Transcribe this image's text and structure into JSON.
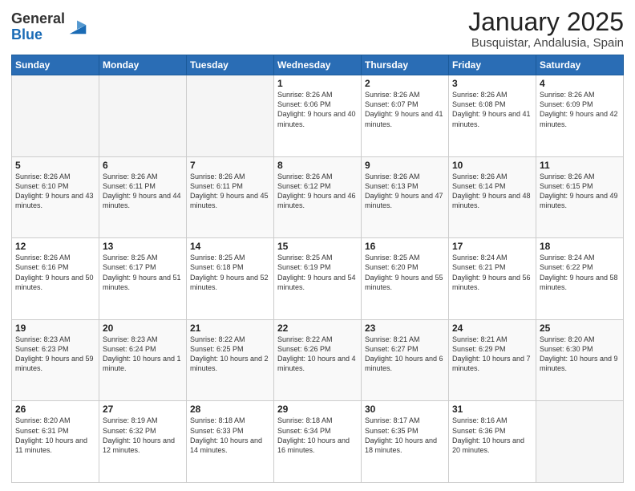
{
  "logo": {
    "general": "General",
    "blue": "Blue"
  },
  "header": {
    "title": "January 2025",
    "subtitle": "Busquistar, Andalusia, Spain"
  },
  "weekdays": [
    "Sunday",
    "Monday",
    "Tuesday",
    "Wednesday",
    "Thursday",
    "Friday",
    "Saturday"
  ],
  "weeks": [
    [
      {
        "day": "",
        "info": ""
      },
      {
        "day": "",
        "info": ""
      },
      {
        "day": "",
        "info": ""
      },
      {
        "day": "1",
        "info": "Sunrise: 8:26 AM\nSunset: 6:06 PM\nDaylight: 9 hours and 40 minutes."
      },
      {
        "day": "2",
        "info": "Sunrise: 8:26 AM\nSunset: 6:07 PM\nDaylight: 9 hours and 41 minutes."
      },
      {
        "day": "3",
        "info": "Sunrise: 8:26 AM\nSunset: 6:08 PM\nDaylight: 9 hours and 41 minutes."
      },
      {
        "day": "4",
        "info": "Sunrise: 8:26 AM\nSunset: 6:09 PM\nDaylight: 9 hours and 42 minutes."
      }
    ],
    [
      {
        "day": "5",
        "info": "Sunrise: 8:26 AM\nSunset: 6:10 PM\nDaylight: 9 hours and 43 minutes."
      },
      {
        "day": "6",
        "info": "Sunrise: 8:26 AM\nSunset: 6:11 PM\nDaylight: 9 hours and 44 minutes."
      },
      {
        "day": "7",
        "info": "Sunrise: 8:26 AM\nSunset: 6:11 PM\nDaylight: 9 hours and 45 minutes."
      },
      {
        "day": "8",
        "info": "Sunrise: 8:26 AM\nSunset: 6:12 PM\nDaylight: 9 hours and 46 minutes."
      },
      {
        "day": "9",
        "info": "Sunrise: 8:26 AM\nSunset: 6:13 PM\nDaylight: 9 hours and 47 minutes."
      },
      {
        "day": "10",
        "info": "Sunrise: 8:26 AM\nSunset: 6:14 PM\nDaylight: 9 hours and 48 minutes."
      },
      {
        "day": "11",
        "info": "Sunrise: 8:26 AM\nSunset: 6:15 PM\nDaylight: 9 hours and 49 minutes."
      }
    ],
    [
      {
        "day": "12",
        "info": "Sunrise: 8:26 AM\nSunset: 6:16 PM\nDaylight: 9 hours and 50 minutes."
      },
      {
        "day": "13",
        "info": "Sunrise: 8:25 AM\nSunset: 6:17 PM\nDaylight: 9 hours and 51 minutes."
      },
      {
        "day": "14",
        "info": "Sunrise: 8:25 AM\nSunset: 6:18 PM\nDaylight: 9 hours and 52 minutes."
      },
      {
        "day": "15",
        "info": "Sunrise: 8:25 AM\nSunset: 6:19 PM\nDaylight: 9 hours and 54 minutes."
      },
      {
        "day": "16",
        "info": "Sunrise: 8:25 AM\nSunset: 6:20 PM\nDaylight: 9 hours and 55 minutes."
      },
      {
        "day": "17",
        "info": "Sunrise: 8:24 AM\nSunset: 6:21 PM\nDaylight: 9 hours and 56 minutes."
      },
      {
        "day": "18",
        "info": "Sunrise: 8:24 AM\nSunset: 6:22 PM\nDaylight: 9 hours and 58 minutes."
      }
    ],
    [
      {
        "day": "19",
        "info": "Sunrise: 8:23 AM\nSunset: 6:23 PM\nDaylight: 9 hours and 59 minutes."
      },
      {
        "day": "20",
        "info": "Sunrise: 8:23 AM\nSunset: 6:24 PM\nDaylight: 10 hours and 1 minute."
      },
      {
        "day": "21",
        "info": "Sunrise: 8:22 AM\nSunset: 6:25 PM\nDaylight: 10 hours and 2 minutes."
      },
      {
        "day": "22",
        "info": "Sunrise: 8:22 AM\nSunset: 6:26 PM\nDaylight: 10 hours and 4 minutes."
      },
      {
        "day": "23",
        "info": "Sunrise: 8:21 AM\nSunset: 6:27 PM\nDaylight: 10 hours and 6 minutes."
      },
      {
        "day": "24",
        "info": "Sunrise: 8:21 AM\nSunset: 6:29 PM\nDaylight: 10 hours and 7 minutes."
      },
      {
        "day": "25",
        "info": "Sunrise: 8:20 AM\nSunset: 6:30 PM\nDaylight: 10 hours and 9 minutes."
      }
    ],
    [
      {
        "day": "26",
        "info": "Sunrise: 8:20 AM\nSunset: 6:31 PM\nDaylight: 10 hours and 11 minutes."
      },
      {
        "day": "27",
        "info": "Sunrise: 8:19 AM\nSunset: 6:32 PM\nDaylight: 10 hours and 12 minutes."
      },
      {
        "day": "28",
        "info": "Sunrise: 8:18 AM\nSunset: 6:33 PM\nDaylight: 10 hours and 14 minutes."
      },
      {
        "day": "29",
        "info": "Sunrise: 8:18 AM\nSunset: 6:34 PM\nDaylight: 10 hours and 16 minutes."
      },
      {
        "day": "30",
        "info": "Sunrise: 8:17 AM\nSunset: 6:35 PM\nDaylight: 10 hours and 18 minutes."
      },
      {
        "day": "31",
        "info": "Sunrise: 8:16 AM\nSunset: 6:36 PM\nDaylight: 10 hours and 20 minutes."
      },
      {
        "day": "",
        "info": ""
      }
    ]
  ]
}
